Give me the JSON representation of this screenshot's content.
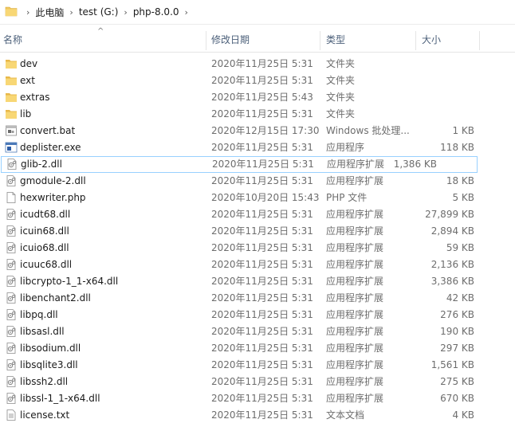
{
  "breadcrumb": [
    "此电脑",
    "test (G:)",
    "php-8.0.0"
  ],
  "columns": {
    "name": "名称",
    "date": "修改日期",
    "type": "类型",
    "size": "大小"
  },
  "files": [
    {
      "name": "dev",
      "date": "2020年11月25日 5:31",
      "type": "文件夹",
      "size": "",
      "icon": "folder-icon"
    },
    {
      "name": "ext",
      "date": "2020年11月25日 5:31",
      "type": "文件夹",
      "size": "",
      "icon": "folder-icon"
    },
    {
      "name": "extras",
      "date": "2020年11月25日 5:43",
      "type": "文件夹",
      "size": "",
      "icon": "folder-icon"
    },
    {
      "name": "lib",
      "date": "2020年11月25日 5:31",
      "type": "文件夹",
      "size": "",
      "icon": "folder-icon"
    },
    {
      "name": "convert.bat",
      "date": "2020年12月15日 17:30",
      "type": "Windows 批处理...",
      "size": "1 KB",
      "icon": "batch-file-icon"
    },
    {
      "name": "deplister.exe",
      "date": "2020年11月25日 5:31",
      "type": "应用程序",
      "size": "118 KB",
      "icon": "exe-icon"
    },
    {
      "name": "glib-2.dll",
      "date": "2020年11月25日 5:31",
      "type": "应用程序扩展",
      "size": "1,386 KB",
      "icon": "dll-icon",
      "selected": true
    },
    {
      "name": "gmodule-2.dll",
      "date": "2020年11月25日 5:31",
      "type": "应用程序扩展",
      "size": "18 KB",
      "icon": "dll-icon"
    },
    {
      "name": "hexwriter.php",
      "date": "2020年10月20日 15:43",
      "type": "PHP 文件",
      "size": "5 KB",
      "icon": "file-icon"
    },
    {
      "name": "icudt68.dll",
      "date": "2020年11月25日 5:31",
      "type": "应用程序扩展",
      "size": "27,899 KB",
      "icon": "dll-icon"
    },
    {
      "name": "icuin68.dll",
      "date": "2020年11月25日 5:31",
      "type": "应用程序扩展",
      "size": "2,894 KB",
      "icon": "dll-icon"
    },
    {
      "name": "icuio68.dll",
      "date": "2020年11月25日 5:31",
      "type": "应用程序扩展",
      "size": "59 KB",
      "icon": "dll-icon"
    },
    {
      "name": "icuuc68.dll",
      "date": "2020年11月25日 5:31",
      "type": "应用程序扩展",
      "size": "2,136 KB",
      "icon": "dll-icon"
    },
    {
      "name": "libcrypto-1_1-x64.dll",
      "date": "2020年11月25日 5:31",
      "type": "应用程序扩展",
      "size": "3,386 KB",
      "icon": "dll-icon"
    },
    {
      "name": "libenchant2.dll",
      "date": "2020年11月25日 5:31",
      "type": "应用程序扩展",
      "size": "42 KB",
      "icon": "dll-icon"
    },
    {
      "name": "libpq.dll",
      "date": "2020年11月25日 5:31",
      "type": "应用程序扩展",
      "size": "276 KB",
      "icon": "dll-icon"
    },
    {
      "name": "libsasl.dll",
      "date": "2020年11月25日 5:31",
      "type": "应用程序扩展",
      "size": "190 KB",
      "icon": "dll-icon"
    },
    {
      "name": "libsodium.dll",
      "date": "2020年11月25日 5:31",
      "type": "应用程序扩展",
      "size": "297 KB",
      "icon": "dll-icon"
    },
    {
      "name": "libsqlite3.dll",
      "date": "2020年11月25日 5:31",
      "type": "应用程序扩展",
      "size": "1,561 KB",
      "icon": "dll-icon"
    },
    {
      "name": "libssh2.dll",
      "date": "2020年11月25日 5:31",
      "type": "应用程序扩展",
      "size": "275 KB",
      "icon": "dll-icon"
    },
    {
      "name": "libssl-1_1-x64.dll",
      "date": "2020年11月25日 5:31",
      "type": "应用程序扩展",
      "size": "670 KB",
      "icon": "dll-icon"
    },
    {
      "name": "license.txt",
      "date": "2020年11月25日 5:31",
      "type": "文本文档",
      "size": "4 KB",
      "icon": "text-file-icon"
    }
  ],
  "colors": {
    "header_text": "#4c607a",
    "folder": "#f0c75e",
    "selection_border": "#99d1ff"
  }
}
